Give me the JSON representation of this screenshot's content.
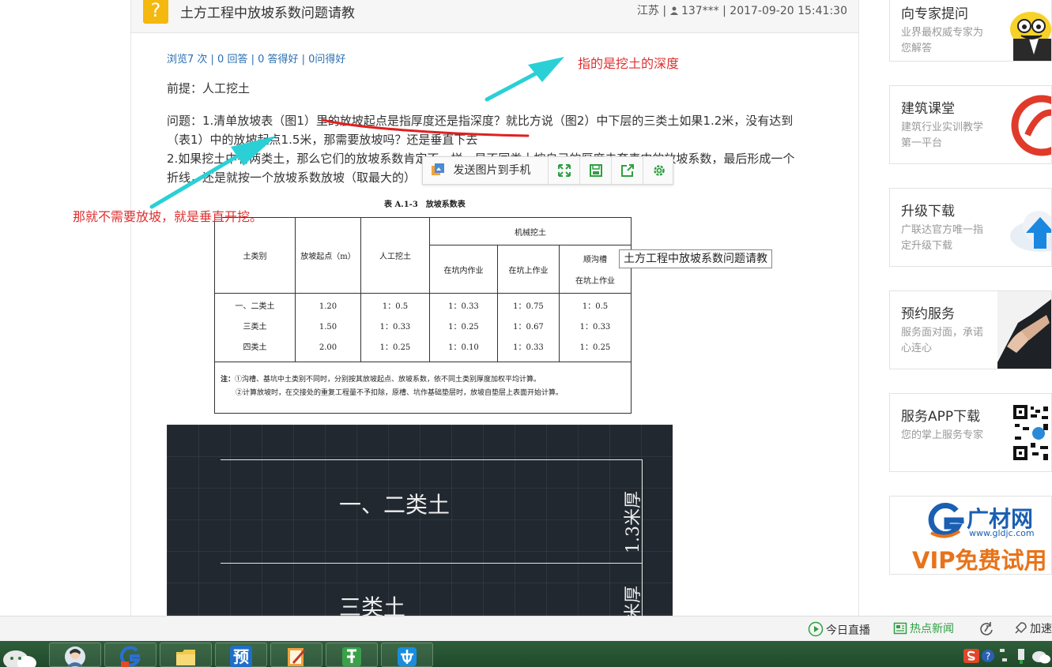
{
  "question": {
    "title": "土方工程中放坡系数问题请教",
    "icon": "question-icon",
    "meta_location": "江苏 | ",
    "meta_user": "137***",
    "meta_time": " | 2017-09-20 15:41:30",
    "stats": "浏览7 次 | 0 回答 | 0 答得好 | 0问得好",
    "premise": "前提：人工挖土",
    "body_line1": "问题：1.清单放坡表（图1）里的放坡起点是指厚度还是指深度？就比方说（图2）中下层的三类土如果1.2米，没有达到",
    "body_line2": "（表1）中的放坡起点1.5米，那需要放坡吗？还是垂直下去",
    "body_line3": "2.如果挖土中有两类土，那么它们的放坡系数肯定不一样，是不同类土按自己的厚度去套表中的放坡系数，最后形成一个",
    "body_line4": "折线，还是就按一个放坡系数放坡（取最大的）"
  },
  "slope_table": {
    "caption": "表 A.1-3　放坡系数表",
    "h_soil": "土类别",
    "h_start": "放坡起点（m）",
    "h_manual": "人工挖土",
    "h_machine": "机械挖土",
    "h_inpit": "在坑内作业",
    "h_onpit": "在坑上作业",
    "h_trench1": "顺沟槽",
    "h_trench2": "在坑上作业",
    "rows": [
      {
        "soil": "一、二类土",
        "start": "1.20",
        "manual": "1：0.5",
        "inpit": "1：0.33",
        "onpit": "1：0.75",
        "trench": "1：0.5"
      },
      {
        "soil": "三类土",
        "start": "1.50",
        "manual": "1：0.33",
        "inpit": "1：0.25",
        "onpit": "1：0.67",
        "trench": "1：0.33"
      },
      {
        "soil": "四类土",
        "start": "2.00",
        "manual": "1：0.25",
        "inpit": "1：0.10",
        "onpit": "1：0.33",
        "trench": "1：0.25"
      }
    ],
    "note_label": "注：",
    "note1": "①沟槽、基坑中土类别不同时，分别按其放坡起点、放坡系数，依不同土类别厚度加权平均计算。",
    "note2": "②计算放坡时，在交接处的重复工程量不予扣除，原槽、坑作基础垫层时，放坡自垫层上表面开始计算。"
  },
  "cad": {
    "layer1": "一、二类土",
    "layer1_thickness": "1.3米厚",
    "layer2": "三类土",
    "layer2_thickness": "米厚"
  },
  "annotations": {
    "top": "指的是挖土的深度",
    "left": "那就不需要放坡，就是垂直开挖。",
    "color": "#e03030",
    "arrow_color": "#2ad0d6"
  },
  "image_toolbar": {
    "send_label": "发送图片到手机"
  },
  "tooltip": "土方工程中放坡系数问题请教",
  "sidebar": [
    {
      "title": "向专家提问",
      "desc": "业界最权威专家为您解答"
    },
    {
      "title": "建筑课堂",
      "desc": "建筑行业实训教学第一平台"
    },
    {
      "title": "升级下载",
      "desc": "广联达官方唯一指定升级下载"
    },
    {
      "title": "预约服务",
      "desc": "服务面对面，承诺心连心"
    },
    {
      "title": "服务APP下载",
      "desc": "您的掌上服务专家"
    }
  ],
  "ad": {
    "logo": "广材网",
    "site": "www.gldjc.com",
    "slogan": "VIP免费试用"
  },
  "statusbar": {
    "live": "今日直播",
    "news": "热点新闻",
    "speed": "加速"
  },
  "taskbar": {
    "app4_char": "预"
  }
}
